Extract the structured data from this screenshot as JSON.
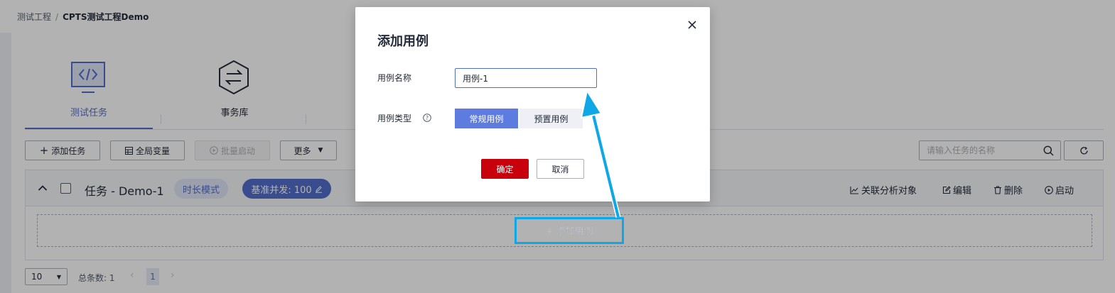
{
  "breadcrumb": {
    "root": "测试工程",
    "separator": "/",
    "current": "CPTS测试工程Demo"
  },
  "tabs": [
    {
      "label": "测试任务",
      "icon": "code-monitor-icon",
      "active": true
    },
    {
      "label": "事务库",
      "icon": "exchange-hexagon-icon",
      "active": false
    }
  ],
  "toolbar": {
    "add_task": "添加任务",
    "global_vars": "全局变量",
    "batch_start": "批量启动",
    "more": "更多",
    "search_placeholder": "请输入任务的名称"
  },
  "task": {
    "name": "任务 - Demo-1",
    "mode_badge": "时长模式",
    "concurrency_badge": "基准并发: 100",
    "actions": {
      "analyze": "关联分析对象",
      "edit": "编辑",
      "delete": "删除",
      "start": "启动"
    },
    "add_case": "+ 添加用例"
  },
  "pagination": {
    "page_size": "10",
    "total": "总条数: 1",
    "current_page": "1"
  },
  "modal": {
    "title": "添加用例",
    "name_label": "用例名称",
    "name_value": "用例-1",
    "type_label": "用例类型",
    "type_options": [
      "常规用例",
      "预置用例"
    ],
    "selected_type": "常规用例",
    "confirm": "确定",
    "cancel": "取消"
  },
  "colors": {
    "accent": "#526ecc",
    "danger": "#c7000b",
    "highlight": "#0fa7e5"
  }
}
